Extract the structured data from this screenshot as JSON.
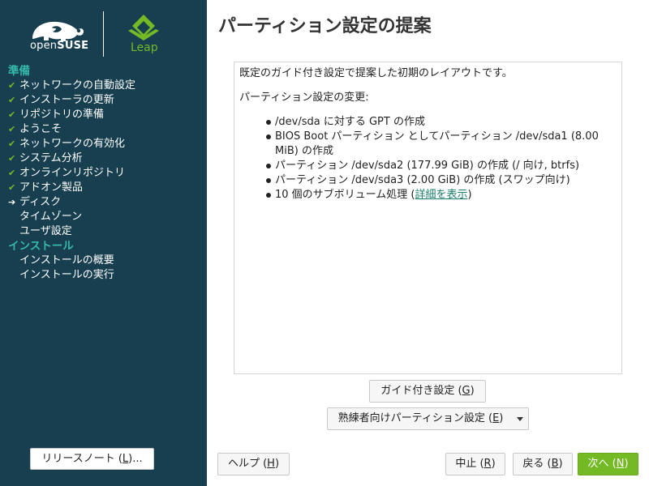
{
  "colors": {
    "sidebar_bg": "#173f4f",
    "section_heading": "#35b9ab",
    "check": "#73ba25",
    "primary_button": "#73ba25",
    "link": "#1a7f6e"
  },
  "branding": {
    "opensuse_prefix": "open",
    "opensuse_suffix": "SUSE",
    "leap": "Leap"
  },
  "sidebar": {
    "sections": [
      {
        "title": "準備",
        "steps": [
          {
            "label": "ネットワークの自動設定",
            "state": "done"
          },
          {
            "label": "インストーラの更新",
            "state": "done"
          },
          {
            "label": "リポジトリの準備",
            "state": "done"
          },
          {
            "label": "ようこそ",
            "state": "done"
          },
          {
            "label": "ネットワークの有効化",
            "state": "done"
          },
          {
            "label": "システム分析",
            "state": "done"
          },
          {
            "label": "オンラインリポジトリ",
            "state": "done"
          },
          {
            "label": "アドオン製品",
            "state": "done"
          },
          {
            "label": "ディスク",
            "state": "current"
          },
          {
            "label": "タイムゾーン",
            "state": "pending"
          },
          {
            "label": "ユーザ設定",
            "state": "pending"
          }
        ]
      },
      {
        "title": "インストール",
        "steps": [
          {
            "label": "インストールの概要",
            "state": "pending"
          },
          {
            "label": "インストールの実行",
            "state": "pending"
          }
        ]
      }
    ],
    "release_notes": {
      "label": "リリースノート (",
      "mnemonic": "L",
      "suffix": ")..."
    }
  },
  "main": {
    "title": "パーティション設定の提案",
    "proposal": {
      "intro": "既定のガイド付き設定で提案した初期のレイアウトです。",
      "changes_heading": "パーティション設定の変更:",
      "changes": [
        "/dev/sda に対する GPT の作成",
        "BIOS Boot パーティション としてパーティション /dev/sda1 (8.00 MiB) の作成",
        "パーティション /dev/sda2 (177.99 GiB) の作成 (/ 向け, btrfs)",
        "パーティション /dev/sda3 (2.00 GiB) の作成 (スワップ向け)"
      ],
      "subvolume_text": "10 個のサブボリューム処理 (",
      "subvolume_link": "詳細を表示",
      "subvolume_close": ")"
    },
    "guided_button": {
      "label": "ガイド付き設定 (",
      "mnemonic": "G",
      "suffix": ")"
    },
    "expert_button": {
      "label": "熟練者向けパーティション設定 (",
      "mnemonic": "E",
      "suffix": ")"
    }
  },
  "footer": {
    "help": {
      "label": "ヘルプ (",
      "mnemonic": "H",
      "suffix": ")"
    },
    "abort": {
      "label": "中止 (",
      "mnemonic": "R",
      "suffix": ")"
    },
    "back": {
      "label": "戻る (",
      "mnemonic": "B",
      "suffix": ")"
    },
    "next": {
      "label": "次へ (",
      "mnemonic": "N",
      "suffix": ")"
    }
  }
}
